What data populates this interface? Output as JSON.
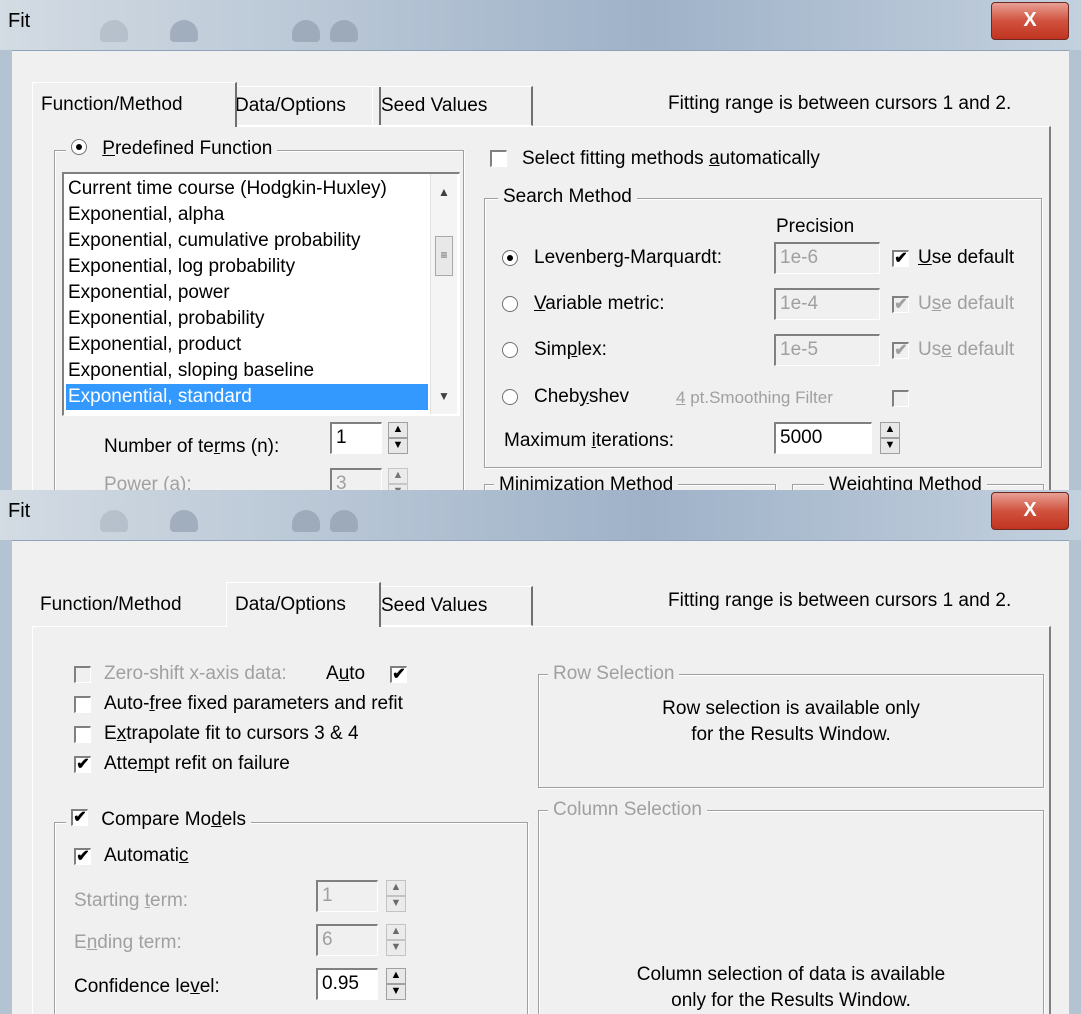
{
  "top": {
    "title": "Fit",
    "close_glyph": "X",
    "tabs": [
      "Function/Method",
      "Data/Options",
      "Seed Values"
    ],
    "range_note": "Fitting range is between cursors 1 and 2.",
    "predefined_label": "Predefined Function",
    "predefined_key": "P",
    "predefined_rest": "redefined Function",
    "functions": [
      "Current time course (Hodgkin-Huxley)",
      "Exponential, alpha",
      "Exponential, cumulative probability",
      "Exponential, log probability",
      "Exponential, power",
      "Exponential, probability",
      "Exponential, product",
      "Exponential, sloping baseline",
      "Exponential, standard"
    ],
    "selected_function": "Exponential, standard",
    "num_terms_label": "Number of terms (n):",
    "num_terms_pre": "Number of te",
    "num_terms_key": "r",
    "num_terms_post": "ms (n):",
    "num_terms_value": "1",
    "power_label": "Power (a):",
    "power_value": "3",
    "auto_select_pre": "Select fitting methods ",
    "auto_select_key": "a",
    "auto_select_post": "utomatically",
    "search_method": "Search Method",
    "precision_header": "Precision",
    "methods": [
      {
        "pre": "Levenberg-Marquardt:",
        "key": "",
        "post": "",
        "precision": "1e-6",
        "use_pre": "",
        "use_key": "U",
        "use_post": "se default",
        "use_checked": true,
        "use_disabled": false,
        "selected": true
      },
      {
        "pre": "",
        "key": "V",
        "post": "ariable metric:",
        "precision": "1e-4",
        "use_pre": "U",
        "use_key": "s",
        "use_post": "e default",
        "use_checked": true,
        "use_disabled": true,
        "selected": false
      },
      {
        "pre": "Sim",
        "key": "p",
        "post": "lex:",
        "precision": "1e-5",
        "use_pre": "Us",
        "use_key": "e",
        "use_post": " default",
        "use_checked": true,
        "use_disabled": true,
        "selected": false
      },
      {
        "pre": "Cheb",
        "key": "y",
        "post": "shev",
        "precision": "",
        "selected": false
      }
    ],
    "smoothing_pre": "",
    "smoothing_key": "4",
    "smoothing_post": " pt.Smoothing Filter",
    "max_iter_pre": "Maximum ",
    "max_iter_key": "i",
    "max_iter_post": "terations:",
    "max_iter_value": "5000",
    "minimization_method": "Minimization Method",
    "weighting_method": "Weighting Method"
  },
  "bottom": {
    "title": "Fit",
    "close_glyph": "X",
    "tabs": [
      "Function/Method",
      "Data/Options",
      "Seed Values"
    ],
    "range_note": "Fitting range is between cursors 1 and 2.",
    "zero_shift_pre": "Zero-shift x-axis data:",
    "auto_pre": "A",
    "auto_key": "u",
    "auto_post": "to",
    "auto_free_pre": "Auto-",
    "auto_free_key": "f",
    "auto_free_post": "ree fixed parameters and refit",
    "extrapolate_pre": "E",
    "extrapolate_key": "x",
    "extrapolate_post": "trapolate fit to cursors 3 & 4",
    "refit_pre": "Atte",
    "refit_key": "m",
    "refit_post": "pt refit on failure",
    "compare_pre": "Compare Mo",
    "compare_key": "d",
    "compare_post": "els",
    "automatic_pre": "Automati",
    "automatic_key": "c",
    "automatic_post": "",
    "starting_pre": "Starting ",
    "starting_key": "t",
    "starting_post": "erm:",
    "starting_value": "1",
    "ending_pre": "E",
    "ending_key": "n",
    "ending_post": "ding term:",
    "ending_value": "6",
    "confidence_pre": "Confidence le",
    "confidence_key": "v",
    "confidence_post": "el:",
    "confidence_value": "0.95",
    "row_selection": "Row Selection",
    "row_note_1": "Row selection is available only",
    "row_note_2": "for the Results Window.",
    "column_selection": "Column Selection",
    "column_note_1": "Column selection of data is available",
    "column_note_2": "only for the Results Window."
  }
}
